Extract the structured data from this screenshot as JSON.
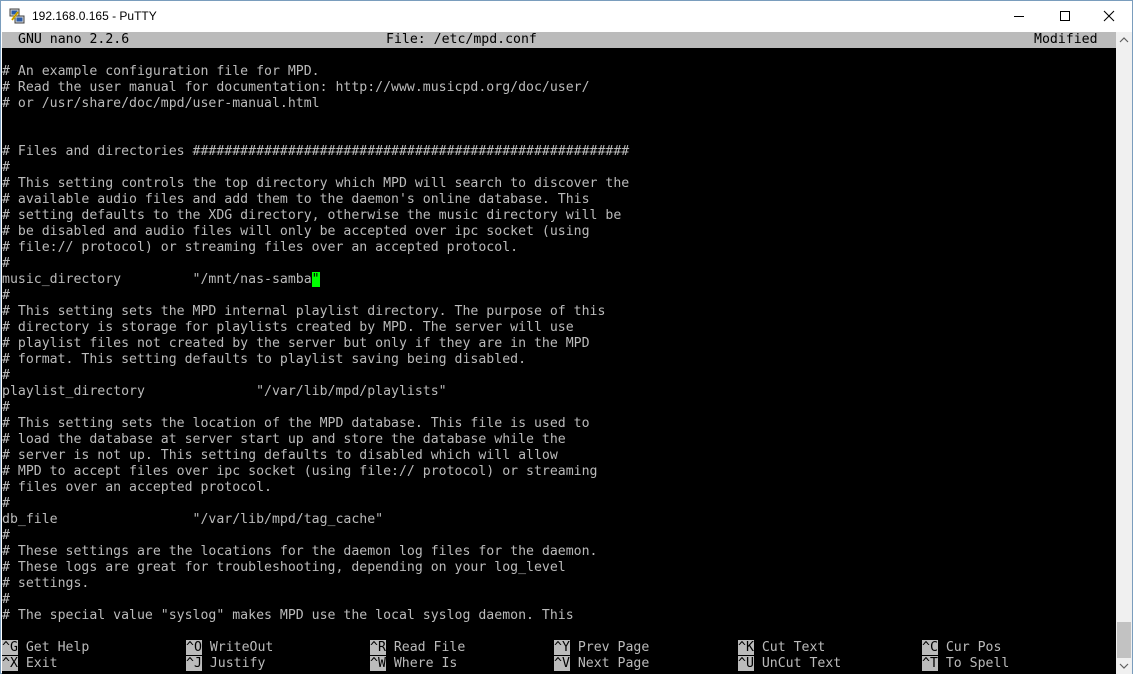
{
  "window": {
    "title": "192.168.0.165 - PuTTY"
  },
  "nano": {
    "version": "GNU nano 2.2.6",
    "file_label": "File: /etc/mpd.conf",
    "status": "Modified"
  },
  "lines": [
    "",
    "# An example configuration file for MPD.",
    "# Read the user manual for documentation: http://www.musicpd.org/doc/user/",
    "# or /usr/share/doc/mpd/user-manual.html",
    "",
    "",
    "# Files and directories #######################################################",
    "#",
    "# This setting controls the top directory which MPD will search to discover the",
    "# available audio files and add them to the daemon's online database. This",
    "# setting defaults to the XDG directory, otherwise the music directory will be",
    "# be disabled and audio files will only be accepted over ipc socket (using",
    "# file:// protocol) or streaming files over an accepted protocol.",
    "#",
    "music_directory         \"/mnt/nas-samba",
    "#",
    "# This setting sets the MPD internal playlist directory. The purpose of this",
    "# directory is storage for playlists created by MPD. The server will use",
    "# playlist files not created by the server but only if they are in the MPD",
    "# format. This setting defaults to playlist saving being disabled.",
    "#",
    "playlist_directory              \"/var/lib/mpd/playlists\"",
    "#",
    "# This setting sets the location of the MPD database. This file is used to",
    "# load the database at server start up and store the database while the",
    "# server is not up. This setting defaults to disabled which will allow",
    "# MPD to accept files over ipc socket (using file:// protocol) or streaming",
    "# files over an accepted protocol.",
    "#",
    "db_file                 \"/var/lib/mpd/tag_cache\"",
    "#",
    "# These settings are the locations for the daemon log files for the daemon.",
    "# These logs are great for troubleshooting, depending on your log_level",
    "# settings.",
    "#",
    "# The special value \"syslog\" makes MPD use the local syslog daemon. This",
    ""
  ],
  "cursor_char": "\"",
  "shortcuts_row1": [
    {
      "key": "^G",
      "label": "Get Help"
    },
    {
      "key": "^O",
      "label": "WriteOut"
    },
    {
      "key": "^R",
      "label": "Read File"
    },
    {
      "key": "^Y",
      "label": "Prev Page"
    },
    {
      "key": "^K",
      "label": "Cut Text"
    },
    {
      "key": "^C",
      "label": "Cur Pos"
    }
  ],
  "shortcuts_row2": [
    {
      "key": "^X",
      "label": "Exit"
    },
    {
      "key": "^J",
      "label": "Justify"
    },
    {
      "key": "^W",
      "label": "Where Is"
    },
    {
      "key": "^V",
      "label": "Next Page"
    },
    {
      "key": "^U",
      "label": "UnCut Text"
    },
    {
      "key": "^T",
      "label": "To Spell"
    }
  ],
  "colors": {
    "terminal_bg": "#000000",
    "terminal_fg": "#bbbbbb",
    "cursor": "#00ff00"
  },
  "icons": {
    "app": "putty-icon",
    "minimize": "minimize-icon",
    "maximize": "maximize-icon",
    "close": "close-icon"
  }
}
